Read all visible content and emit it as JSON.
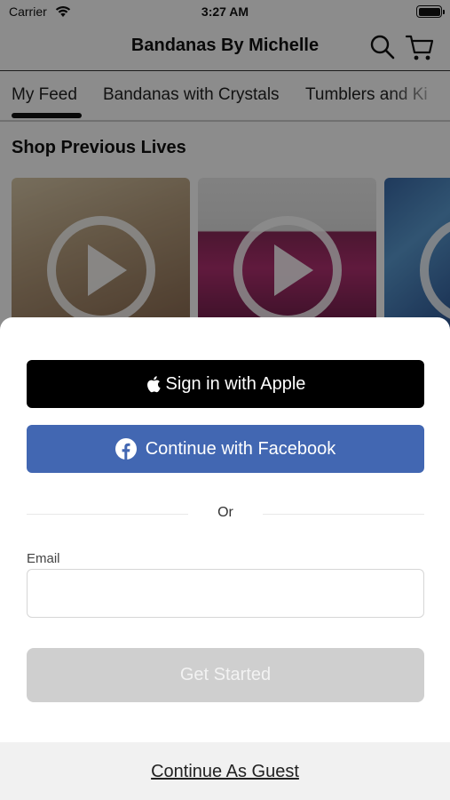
{
  "status_bar": {
    "carrier": "Carrier",
    "time": "3:27 AM"
  },
  "nav": {
    "title": "Bandanas By Michelle"
  },
  "tabs": [
    {
      "label": "My Feed",
      "selected": true
    },
    {
      "label": "Bandanas with Crystals",
      "selected": false
    },
    {
      "label": "Tumblers and Ki",
      "selected": false
    }
  ],
  "feed": {
    "section_title": "Shop Previous Lives"
  },
  "sheet": {
    "apple_button": "Sign in with Apple",
    "facebook_button": "Continue with Facebook",
    "divider_text": "Or",
    "email_label": "Email",
    "email_value": "",
    "email_placeholder": "",
    "get_started_button": "Get Started",
    "guest_link": "Continue As Guest"
  },
  "colors": {
    "facebook_blue": "#4267b2",
    "apple_black": "#000000",
    "disabled_button": "#cfcfcf",
    "guest_bar": "#f1f1f1"
  }
}
